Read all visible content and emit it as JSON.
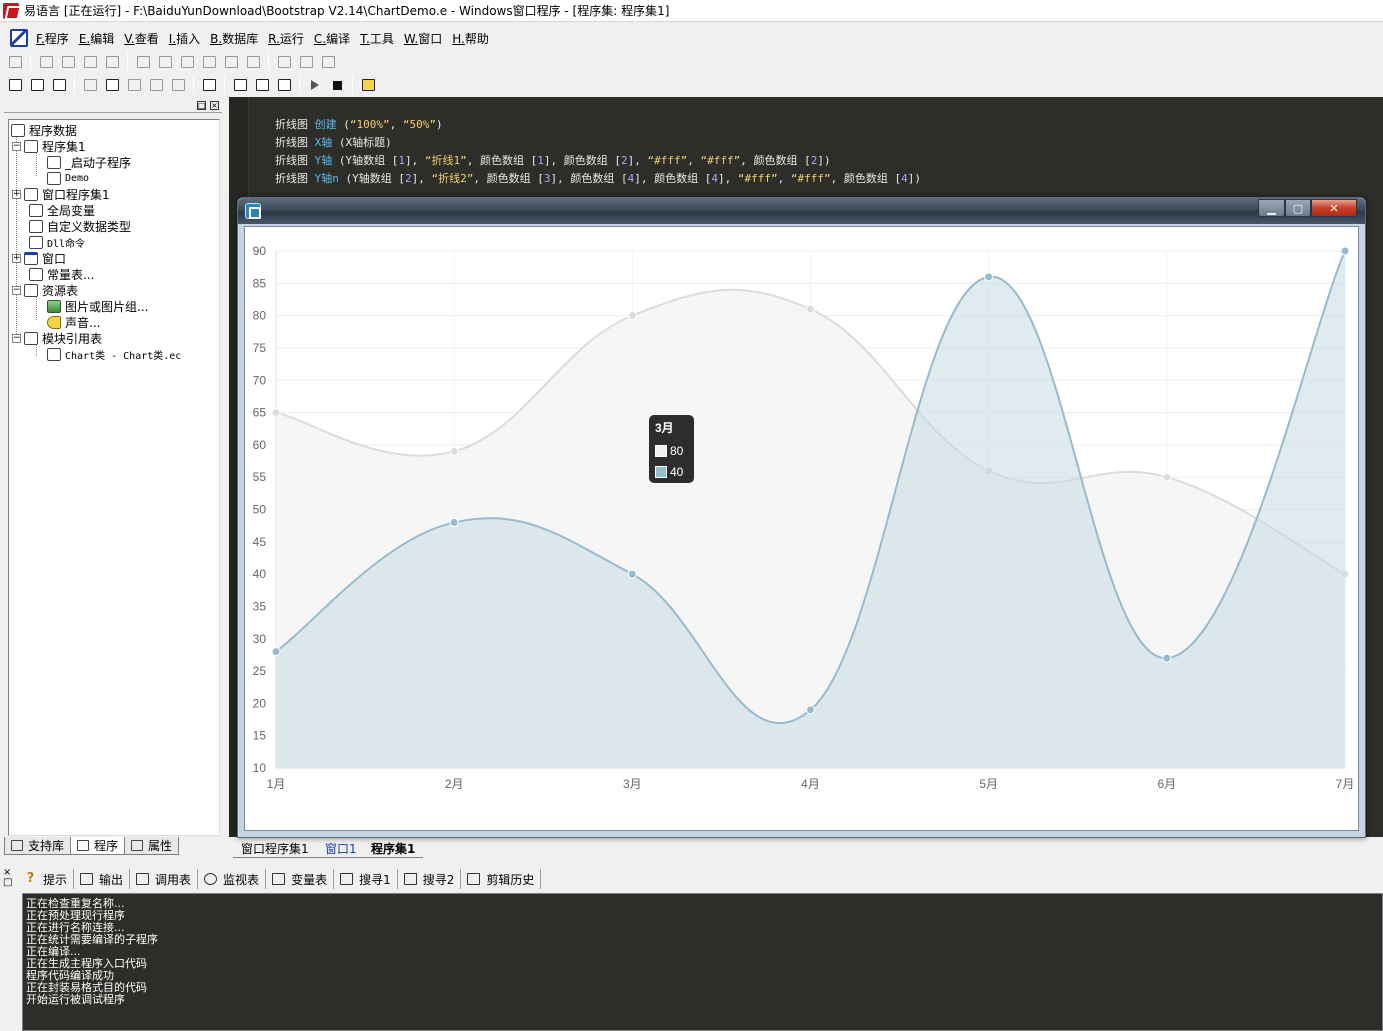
{
  "window": {
    "title": "易语言 [正在运行] - F:\\BaiduYunDownload\\Bootstrap V2.14\\ChartDemo.e - Windows窗口程序 - [程序集: 程序集1]"
  },
  "menu": {
    "items": [
      "F.程序",
      "E.编辑",
      "V.查看",
      "I.插入",
      "B.数据库",
      "R.运行",
      "C.编译",
      "T.工具",
      "W.窗口",
      "H.帮助"
    ]
  },
  "tree": {
    "items": [
      "程序数据",
      "程序集1",
      "_启动子程序",
      "Demo",
      "窗口程序集1",
      "全局变量",
      "自定义数据类型",
      "Dll命令",
      "窗口",
      "常量表...",
      "资源表",
      "图片或图片组...",
      "声音...",
      "模块引用表",
      "Chart类 - Chart类.ec"
    ]
  },
  "left_tabs": [
    "支持库",
    "程序",
    "属性"
  ],
  "code": {
    "lines": [
      [
        {
          "t": "折线图 ",
          "c": "p"
        },
        {
          "t": "创建",
          "c": "kw"
        },
        {
          "t": " (",
          "c": "p"
        },
        {
          "t": "“100%”",
          "c": "str"
        },
        {
          "t": ", ",
          "c": "p"
        },
        {
          "t": "“50%”",
          "c": "str"
        },
        {
          "t": ")",
          "c": "p"
        }
      ],
      [
        {
          "t": "折线图 ",
          "c": "p"
        },
        {
          "t": "X轴",
          "c": "kw"
        },
        {
          "t": " (X轴标题)",
          "c": "p"
        }
      ],
      [
        {
          "t": "折线图 ",
          "c": "p"
        },
        {
          "t": "Y轴",
          "c": "kw"
        },
        {
          "t": " (Y轴数组 [",
          "c": "p"
        },
        {
          "t": "1",
          "c": "num"
        },
        {
          "t": "], ",
          "c": "p"
        },
        {
          "t": "“折线1”",
          "c": "str"
        },
        {
          "t": ", 颜色数组 [",
          "c": "p"
        },
        {
          "t": "1",
          "c": "num"
        },
        {
          "t": "], 颜色数组 [",
          "c": "p"
        },
        {
          "t": "2",
          "c": "num"
        },
        {
          "t": "], ",
          "c": "p"
        },
        {
          "t": "“#fff”",
          "c": "str"
        },
        {
          "t": ", ",
          "c": "p"
        },
        {
          "t": "“#fff”",
          "c": "str"
        },
        {
          "t": ", 颜色数组 [",
          "c": "p"
        },
        {
          "t": "2",
          "c": "num"
        },
        {
          "t": "])",
          "c": "p"
        }
      ],
      [
        {
          "t": "折线图 ",
          "c": "p"
        },
        {
          "t": "Y轴n",
          "c": "kw"
        },
        {
          "t": " (Y轴数组 [",
          "c": "p"
        },
        {
          "t": "2",
          "c": "num"
        },
        {
          "t": "], ",
          "c": "p"
        },
        {
          "t": "“折线2”",
          "c": "str"
        },
        {
          "t": ", 颜色数组 [",
          "c": "p"
        },
        {
          "t": "3",
          "c": "num"
        },
        {
          "t": "], 颜色数组 [",
          "c": "p"
        },
        {
          "t": "4",
          "c": "num"
        },
        {
          "t": "], 颜色数组 [",
          "c": "p"
        },
        {
          "t": "4",
          "c": "num"
        },
        {
          "t": "], ",
          "c": "p"
        },
        {
          "t": "“#fff”",
          "c": "str"
        },
        {
          "t": ", ",
          "c": "p"
        },
        {
          "t": "“#fff”",
          "c": "str"
        },
        {
          "t": ", 颜色数组 [",
          "c": "p"
        },
        {
          "t": "4",
          "c": "num"
        },
        {
          "t": "])",
          "c": "p"
        }
      ]
    ]
  },
  "chart_data": {
    "type": "area",
    "categories": [
      "1月",
      "2月",
      "3月",
      "4月",
      "5月",
      "6月",
      "7月"
    ],
    "series": [
      {
        "values": [
          65,
          59,
          80,
          81,
          56,
          55,
          40
        ],
        "fill": "#f5f5f5",
        "stroke": "#dcdcdc"
      },
      {
        "values": [
          28,
          48,
          40,
          19,
          86,
          27,
          90
        ],
        "fill": "#c6dae3",
        "stroke": "#97bbcd"
      }
    ],
    "ylim": [
      10,
      90
    ],
    "yticks": [
      10,
      15,
      20,
      25,
      30,
      35,
      40,
      45,
      50,
      55,
      60,
      65,
      70,
      75,
      80,
      85,
      90
    ],
    "grid": true,
    "tooltip": {
      "title": "3月",
      "values": [
        "80",
        "40"
      ]
    }
  },
  "editor_tabs": [
    "窗口程序集1",
    "窗口1",
    "程序集1"
  ],
  "output_tabs": [
    "提示",
    "输出",
    "调用表",
    "监视表",
    "变量表",
    "搜寻1",
    "搜寻2",
    "剪辑历史"
  ],
  "output_lines": [
    "正在检查重复名称...",
    "正在预处理现行程序",
    "正在进行名称连接...",
    "正在统计需要编译的子程序",
    "正在编译...",
    "正在生成主程序入口代码",
    "程序代码编译成功",
    "正在封装易格式目的代码",
    "开始运行被调试程序"
  ]
}
